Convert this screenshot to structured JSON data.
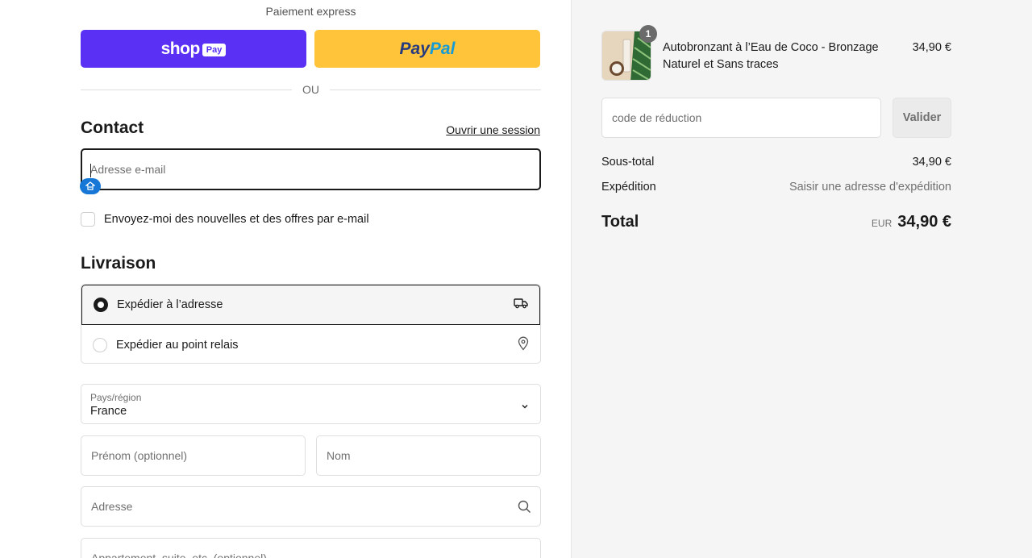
{
  "express": {
    "title": "Paiement express",
    "shop_word": "shop",
    "shop_pay": "Pay",
    "paypal_a": "Pay",
    "paypal_b": "Pal",
    "divider": "OU"
  },
  "contact": {
    "heading": "Contact",
    "login_link": "Ouvrir une session",
    "email_placeholder": "Adresse e-mail",
    "newsletter_label": "Envoyez-moi des nouvelles et des offres par e-mail"
  },
  "delivery": {
    "heading": "Livraison",
    "options": [
      {
        "label": "Expédier à l’adresse",
        "selected": true,
        "icon": "truck-icon"
      },
      {
        "label": "Expédier au point relais",
        "selected": false,
        "icon": "location-pin-icon"
      }
    ],
    "country": {
      "label": "Pays/région",
      "value": "France"
    },
    "firstname_placeholder": "Prénom (optionnel)",
    "lastname_placeholder": "Nom",
    "address_placeholder": "Adresse",
    "apartment_placeholder": "Appartement, suite, etc. (optionnel)"
  },
  "summary": {
    "product": {
      "name": "Autobronzant à l’Eau de Coco - Bronzage Naturel et Sans traces",
      "price": "34,90 €",
      "quantity": "1"
    },
    "discount_placeholder": "code de réduction",
    "apply_button": "Valider",
    "subtotal_label": "Sous-total",
    "subtotal_value": "34,90 €",
    "shipping_label": "Expédition",
    "shipping_value": "Saisir une adresse d'expédition",
    "total_label": "Total",
    "currency": "EUR",
    "total_value": "34,90 €"
  },
  "colors": {
    "shop_purple": "#5a31f4",
    "paypal_yellow": "#ffc439",
    "sidebar_bg": "#f5f5f5"
  }
}
